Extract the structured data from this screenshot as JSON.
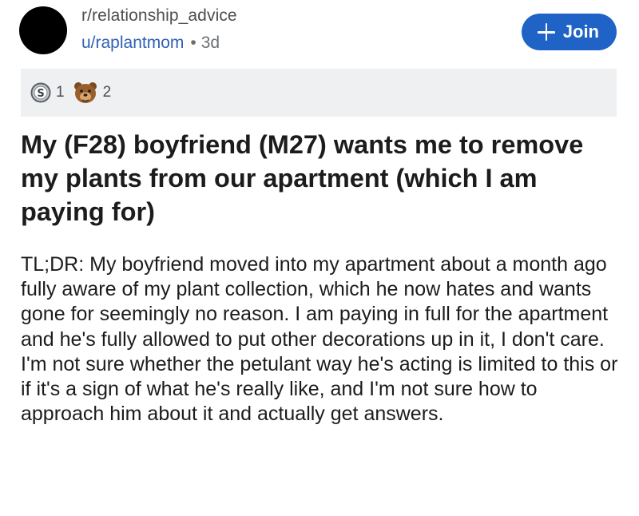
{
  "post": {
    "subreddit": "r/relationship_advice",
    "username": "u/raplantmom",
    "separator": "•",
    "age": "3d",
    "join_label": "Join",
    "awards": [
      {
        "icon": "silver-award-icon",
        "count": "1"
      },
      {
        "icon": "bear-award-icon",
        "count": "2"
      }
    ],
    "title": "My (F28) boyfriend (M27) wants me to remove my plants from our apartment (which I am paying for)",
    "body": "TL;DR: My boyfriend moved into my apartment about a month ago fully aware of my plant collection, which he now hates and wants gone for seemingly no reason. I am paying in full for the apartment and he's fully allowed to put other decorations up in it, I don't care. I'm not sure whether the petulant way he's acting is limited to this or if it's a sign of what he's really like, and I'm not sure how to approach him about it and actually get answers."
  },
  "colors": {
    "join_button": "#1f63c6",
    "username": "#2f61b5",
    "awards_background": "#eef0f2"
  }
}
